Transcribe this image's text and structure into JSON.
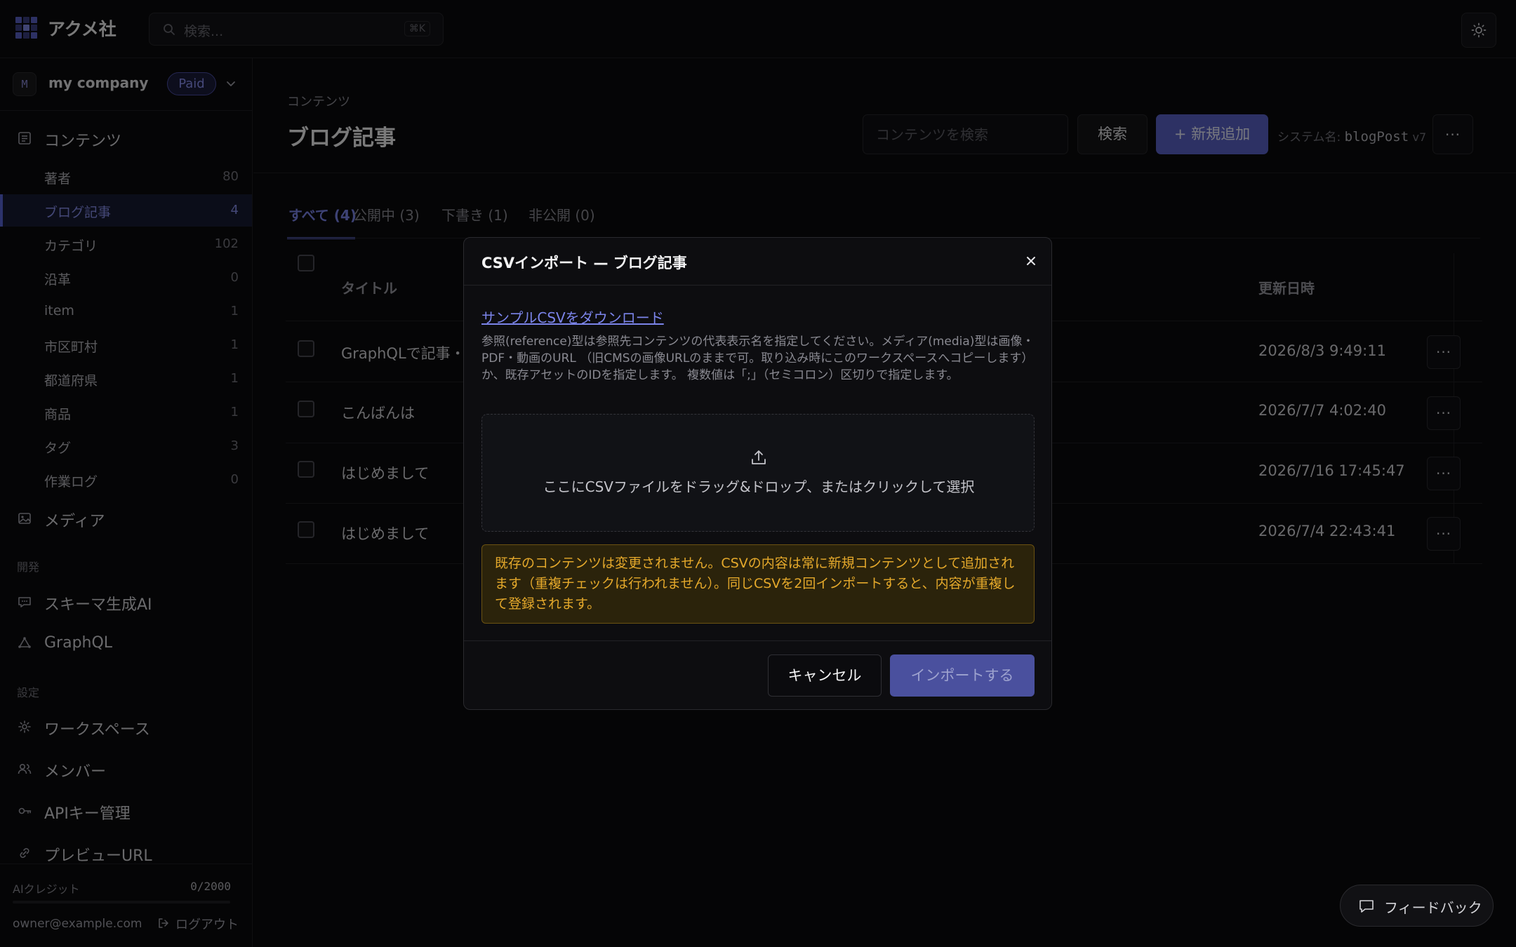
{
  "app": {
    "brand": "アクメ社",
    "search_placeholder": "検索...",
    "search_shortcut": "⌘K"
  },
  "workspace": {
    "avatar_letter": "M",
    "name": "my company",
    "plan_badge": "Paid"
  },
  "sidebar": {
    "contents_label": "コンテンツ",
    "content_types": [
      {
        "label": "著者",
        "count": "80"
      },
      {
        "label": "ブログ記事",
        "count": "4"
      },
      {
        "label": "カテゴリ",
        "count": "102"
      },
      {
        "label": "沿革",
        "count": "0"
      },
      {
        "label": "item",
        "count": "1"
      },
      {
        "label": "市区町村",
        "count": "1"
      },
      {
        "label": "都道府県",
        "count": "1"
      },
      {
        "label": "商品",
        "count": "1"
      },
      {
        "label": "タグ",
        "count": "3"
      },
      {
        "label": "作業ログ",
        "count": "0"
      }
    ],
    "media_label": "メディア",
    "dev_heading": "開発",
    "schema_ai_label": "スキーマ生成AI",
    "graphql_label": "GraphQL",
    "settings_heading": "設定",
    "workspace_label": "ワークスペース",
    "members_label": "メンバー",
    "apikeys_label": "APIキー管理",
    "preview_label": "プレビューURL",
    "ai_credit_label": "AIクレジット",
    "ai_credit_value": "0/2000",
    "ai_credit_fraction": 0,
    "user_email": "owner@example.com",
    "logout_label": "ログアウト"
  },
  "header": {
    "breadcrumb": "コンテンツ",
    "title": "ブログ記事",
    "search_placeholder": "コンテンツを検索",
    "search_button": "検索",
    "add_button": "+ 新規追加",
    "system_name_label": "システム名:",
    "system_name_value": "blogPost",
    "version": "v7"
  },
  "tabs": [
    {
      "label": "すべて (4)"
    },
    {
      "label": "公開中 (3)"
    },
    {
      "label": "下書き (1)"
    },
    {
      "label": "非公開 (0)"
    }
  ],
  "table": {
    "col_title": "タイトル",
    "col_updated": "更新日時",
    "rows": [
      {
        "title": "GraphQLで記事・",
        "updated": "2026/8/3 9:49:11"
      },
      {
        "title": "こんばんは",
        "updated": "2026/7/7 4:02:40"
      },
      {
        "title": "はじめまして",
        "updated": "2026/7/16 17:45:47"
      },
      {
        "title": "はじめまして",
        "updated": "2026/7/4 22:43:41"
      }
    ]
  },
  "modal": {
    "title": "CSVインポート — ブログ記事",
    "download_link": "サンプルCSVをダウンロード",
    "note": "参照(reference)型は参照先コンテンツの代表表示名を指定してください。メディア(media)型は画像・PDF・動画のURL （旧CMSの画像URLのままで可。取り込み時にこのワークスペースへコピーします）か、既存アセットのIDを指定します。 複数値は「;」（セミコロン）区切りで指定します。",
    "dropzone_text": "ここにCSVファイルをドラッグ&ドロップ、またはクリックして選択",
    "warning": "既存のコンテンツは変更されません。CSVの内容は常に新規コンテンツとして追加されます（重複チェックは行われません）。同じCSVを2回インポートすると、内容が重複して登録されます。",
    "cancel_button": "キャンセル",
    "import_button": "インポートする"
  },
  "feedback_button": "フィードバック",
  "colors": {
    "accent": "#5b63c9",
    "background": "#0a0a0c",
    "warning_text": "#e5a92b",
    "warning_bg": "#2b230b"
  }
}
